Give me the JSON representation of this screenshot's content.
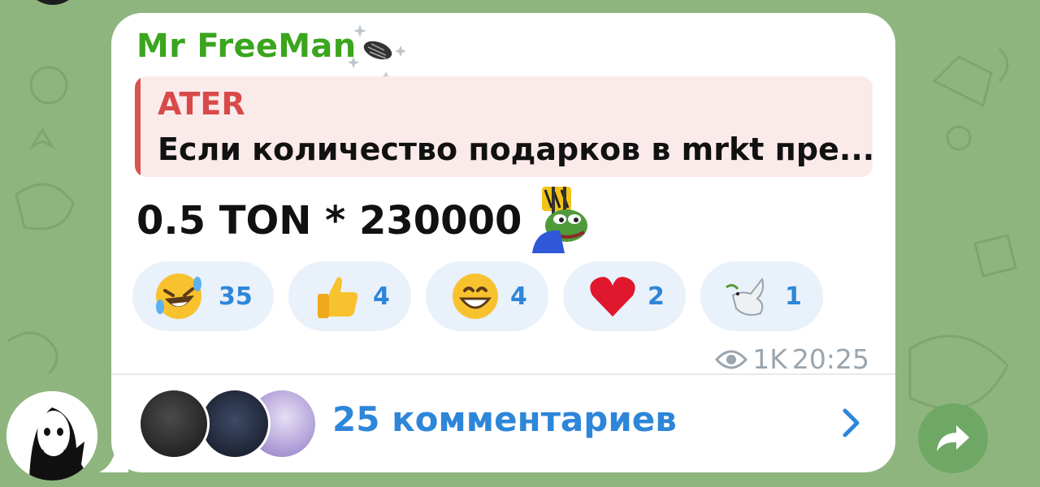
{
  "message": {
    "sender_name": "Mr FreeMan",
    "reply": {
      "author": "ATER",
      "text": "Если количество подарков в mrkt пре..."
    },
    "text": "0.5 TON * 230000",
    "reactions": [
      {
        "emoji": "rolling-on-floor-laughing",
        "glyph": "🤣",
        "count": "35"
      },
      {
        "emoji": "thumbs-up",
        "glyph": "👍",
        "count": "4"
      },
      {
        "emoji": "grinning-face",
        "glyph": "😁",
        "count": "4"
      },
      {
        "emoji": "red-heart",
        "glyph": "❤️",
        "count": "2"
      },
      {
        "emoji": "dove",
        "glyph": "🕊",
        "count": "1"
      }
    ],
    "views": "1K",
    "time": "20:25"
  },
  "comments": {
    "label": "25 комментариев"
  },
  "colors": {
    "sender_name": "#3aa51d",
    "quote_accent": "#d84a4a",
    "link_blue": "#2e86d9",
    "chat_background": "#8fb57f",
    "share_button": "#6ea864"
  }
}
